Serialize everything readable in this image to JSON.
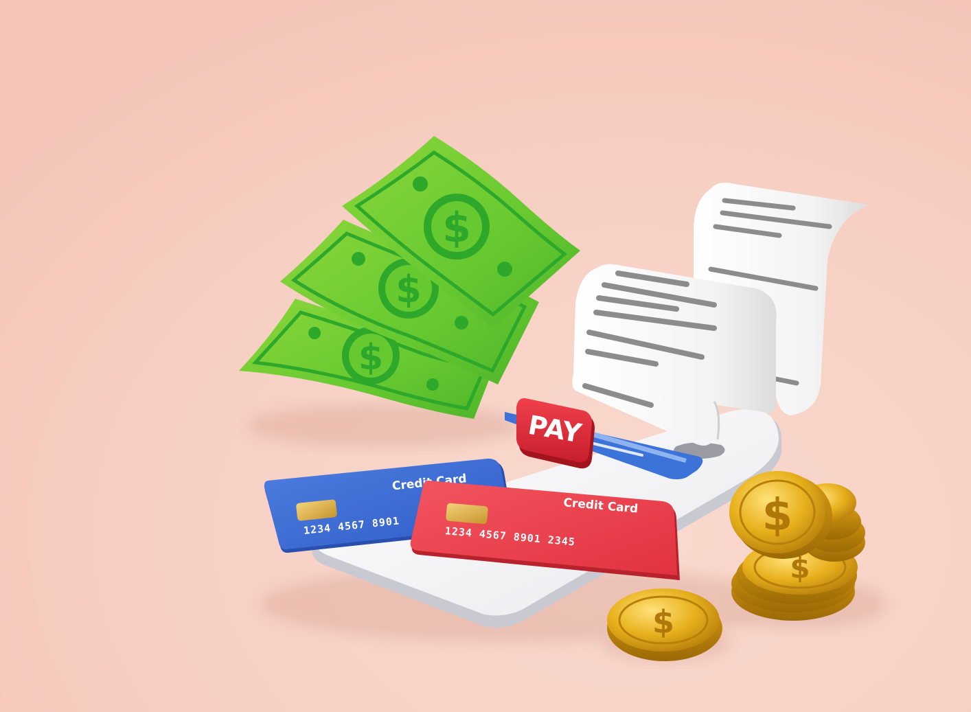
{
  "scene": {
    "background_color": "#f7cfc3",
    "accent_colors": {
      "bill_green": "#66c930",
      "bill_dark_green": "#2ea82a",
      "card_blue": "#3f6fd6",
      "card_red": "#ea3b48",
      "pay_red": "#e32636",
      "coin_gold": "#e0a716",
      "receipt_white": "#f4f4f4",
      "receipt_line_gray": "#8c8c8c",
      "phone_white": "#f6f6f8"
    }
  },
  "bills": {
    "symbol": "$",
    "count": 3
  },
  "pay_badge": {
    "label": "PAY"
  },
  "cards": {
    "blue": {
      "title": "Credit Card",
      "number": "1234 4567 8901"
    },
    "red": {
      "title": "Credit Card",
      "number": "1234 4567 8901 2345"
    }
  },
  "coins": {
    "symbol": "$"
  },
  "icons": [
    "banknote-icon",
    "credit-card-icon",
    "receipt-icon",
    "smartphone-icon",
    "coin-icon"
  ]
}
